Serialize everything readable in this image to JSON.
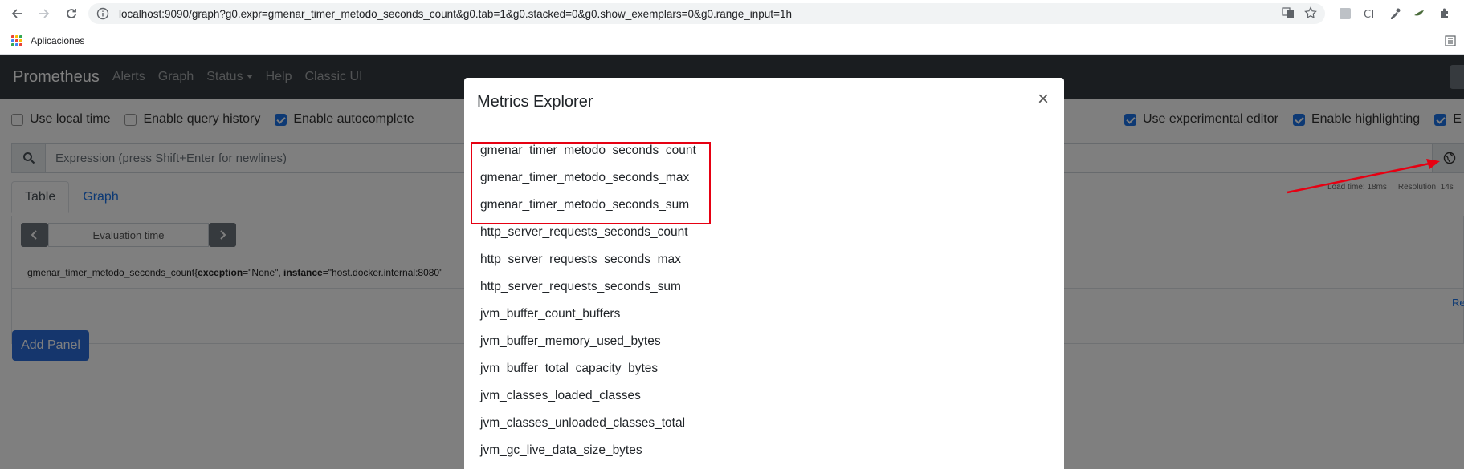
{
  "browser": {
    "url": "localhost:9090/graph?g0.expr=gmenar_timer_metodo_seconds_count&g0.tab=1&g0.stacked=0&g0.show_exemplars=0&g0.range_input=1h",
    "bookmark_apps_label": "Aplicaciones"
  },
  "navbar": {
    "brand": "Prometheus",
    "links": [
      "Alerts",
      "Graph",
      "Status",
      "Help",
      "Classic UI"
    ]
  },
  "options": {
    "left": [
      {
        "label": "Use local time",
        "checked": false
      },
      {
        "label": "Enable query history",
        "checked": false
      },
      {
        "label": "Enable autocomplete",
        "checked": true
      }
    ],
    "right": [
      {
        "label": "Use experimental editor",
        "checked": true
      },
      {
        "label": "Enable highlighting",
        "checked": true
      },
      {
        "label": "E",
        "checked": true
      }
    ]
  },
  "expression": {
    "placeholder": "Expression (press Shift+Enter for newlines)"
  },
  "stats": {
    "load_time": "Load time: 18ms",
    "resolution": "Resolution: 14s"
  },
  "tabs": {
    "table": "Table",
    "graph": "Graph"
  },
  "eval": {
    "label": "Evaluation time"
  },
  "result": {
    "metric": "gmenar_timer_metodo_seconds_count{",
    "label1_key": "exception",
    "label1_val": "=\"None\", ",
    "label2_key": "instance",
    "label2_val": "=\"host.docker.internal:8080\""
  },
  "remove_link": "Re",
  "add_panel": "Add Panel",
  "modal": {
    "title": "Metrics Explorer",
    "close": "×",
    "metrics": [
      "gmenar_timer_metodo_seconds_count",
      "gmenar_timer_metodo_seconds_max",
      "gmenar_timer_metodo_seconds_sum",
      "http_server_requests_seconds_count",
      "http_server_requests_seconds_max",
      "http_server_requests_seconds_sum",
      "jvm_buffer_count_buffers",
      "jvm_buffer_memory_used_bytes",
      "jvm_buffer_total_capacity_bytes",
      "jvm_classes_loaded_classes",
      "jvm_classes_unloaded_classes_total",
      "jvm_gc_live_data_size_bytes"
    ]
  },
  "colors": {
    "navbar": "#343a40",
    "accent": "#1a73e8",
    "annotation": "#e60012"
  }
}
